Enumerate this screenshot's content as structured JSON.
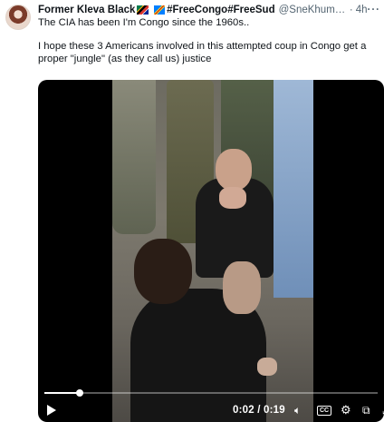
{
  "tweet": {
    "author_name": "Former Kleva Black",
    "hashtags": "#FreeCongo#FreeSud",
    "handle": "@SneKhumaloS",
    "dot": "·",
    "time": "4h",
    "more": "···",
    "text_line1": "The CIA has been I'm Congo since the 1960s..",
    "text_line2": "I hope these 3 Americans involved in this attempted coup in Congo get a proper \"jungle\" (as they call us) justice"
  },
  "video": {
    "timecode": "0:02 / 0:19",
    "progress": 0.105,
    "icons": [
      "play-icon",
      "volume-icon",
      "captions-icon",
      "settings-icon",
      "picture-in-picture-icon",
      "fullscreen-icon"
    ]
  },
  "colors": {
    "text": "#0f1419",
    "secondary": "#536471",
    "media_bg": "#000000"
  }
}
